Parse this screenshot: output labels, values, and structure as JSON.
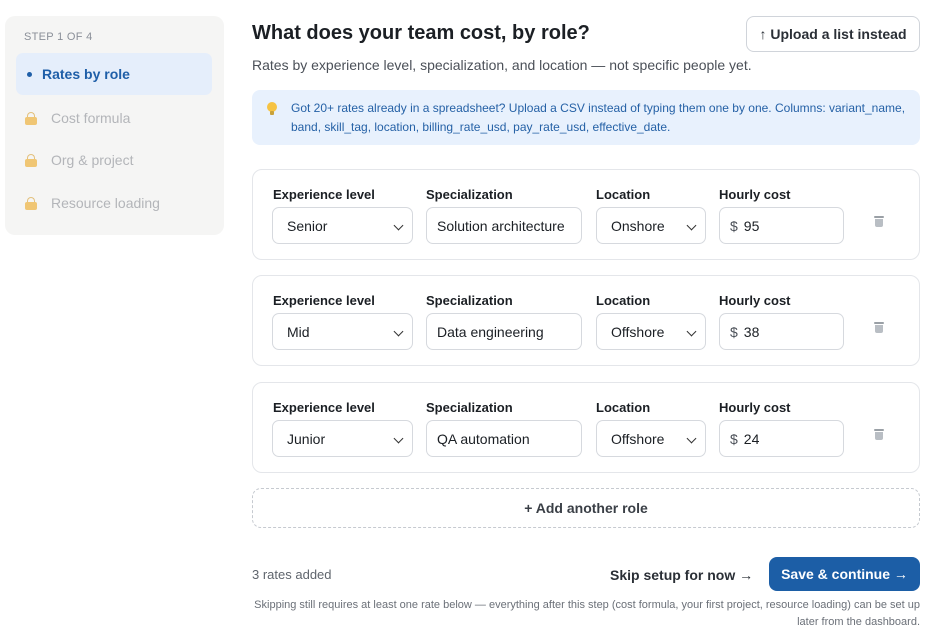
{
  "sidebar": {
    "step_label": "STEP 1 OF 4",
    "items": [
      {
        "label": "Rates by role",
        "state": "active"
      },
      {
        "label": "Cost formula",
        "state": "locked"
      },
      {
        "label": "Org & project",
        "state": "locked"
      },
      {
        "label": "Resource loading",
        "state": "locked"
      }
    ]
  },
  "header": {
    "title": "What does your team cost, by role?",
    "subtitle": "Rates by experience level, specialization, and location — not specific people yet.",
    "upload_button": "↑ Upload a list instead"
  },
  "banner": {
    "icon": "lightbulb-icon",
    "text": "Got 20+ rates already in a spreadsheet? Upload a CSV instead of typing them one by one. Columns: variant_name, band, skill_tag, location, billing_rate_usd, pay_rate_usd, effective_date."
  },
  "labels": {
    "experience": "Experience level",
    "specialization": "Specialization",
    "location": "Location",
    "hourly": "Hourly cost",
    "currency": "$"
  },
  "roles": [
    {
      "experience": "Senior",
      "specialization": "Solution architecture",
      "location": "Onshore",
      "cost": "95"
    },
    {
      "experience": "Mid",
      "specialization": "Data engineering",
      "location": "Offshore",
      "cost": "38"
    },
    {
      "experience": "Junior",
      "specialization": "QA automation",
      "location": "Offshore",
      "cost": "24"
    }
  ],
  "add_role_label": "+ Add another role",
  "footer": {
    "rates_count": "3 rates added",
    "skip_label": "Skip setup for now →",
    "save_label": "Save & continue →",
    "note": "Skipping still requires at least one rate below — everything after this step (cost formula, your first project, resource loading) can be set up later from the dashboard."
  },
  "colors": {
    "accent": "#1c5ea6",
    "active_nav_bg": "#e5eefb",
    "banner_bg": "#e8f1fd"
  }
}
